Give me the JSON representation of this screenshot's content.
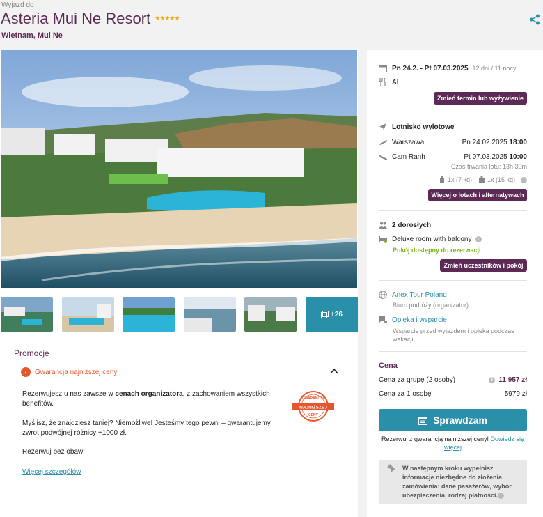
{
  "header": {
    "kicker": "Wyjazd do",
    "title": "Asteria Mui Ne Resort",
    "stars": "★★★★★",
    "location": "Wietnam, Mui Ne"
  },
  "gallery": {
    "more_label": "+26"
  },
  "promo": {
    "section_title": "Promocje",
    "guarantee_label": "Gwarancja najniższej ceny",
    "text1_a": "Rezerwujesz u nas zawsze w ",
    "text1_bold": "cenach organizatora",
    "text1_b": ", z zachowaniem wszystkich benefitów.",
    "text2": "Myślisz, że znajdziesz taniej? Niemożliwe! Jesteśmy tego pewni – gwarantujemy zwrot podwójnej różnicy +1000 zł.",
    "text3": "Rezerwuj bez obaw!",
    "more_link": "Więcej szczegółów",
    "stamp_top": "GWARANCJA",
    "stamp_mid": "NAJNIŻSZEJ",
    "stamp_bot": "CENY"
  },
  "trip": {
    "dates": "Pn 24.2. - Pt 07.03.2025",
    "duration": "12 dni / 11 nocy",
    "board": "AI",
    "change_button": "Zmień termin lub wyżywienie"
  },
  "flights": {
    "heading": "Lotnisko wylotowe",
    "outbound_city": "Warszawa",
    "outbound_date": "Pn 24.02.2025",
    "outbound_time": "18:00",
    "return_city": "Cam Ranh",
    "return_date": "Pt 07.03.2025",
    "return_time": "10:00",
    "flight_duration": "Czas trwania lotu: 13h 30m",
    "hand_luggage": "1x (7 kg)",
    "checked_luggage": "1x (15 kg)",
    "more_button": "Więcej o lotach i alternatywach"
  },
  "room": {
    "guests": "2 dorosłych",
    "room_type": "Deluxe room with balcony",
    "availability": "Pokój dostępny do rezerwacji",
    "change_button": "Zmień uczestników i pokój"
  },
  "organizer": {
    "name": "Anex Tour Poland",
    "role": "Biuro podróży (organizator)",
    "support_link": "Opieka i wsparcie",
    "support_desc": "Wsparcie przed wyjazdem i opieka podczas wakacji."
  },
  "price": {
    "heading": "Cena",
    "group_label": "Cena za grupę (2 osoby)",
    "group_value": "11 957 zł",
    "person_label": "Cena za 1 osobę",
    "person_value": "5979 zł",
    "check_button": "Sprawdzam",
    "guarantee_text": "Rezerwuj z gwarancją najniższej ceny!",
    "guarantee_link": "Dowiedz się więcej"
  },
  "next_step": {
    "text": "W następnym kroku wypełnisz informacje niezbędne do złożenia zamówienia: dane pasażerów, wybór ubezpieczenia, rodzaj płatności."
  },
  "colors": {
    "brand": "#5c2a55",
    "accent": "#2a8fa8",
    "promo": "#e4572e",
    "available": "#7cb518",
    "stars": "#f3a91c"
  }
}
